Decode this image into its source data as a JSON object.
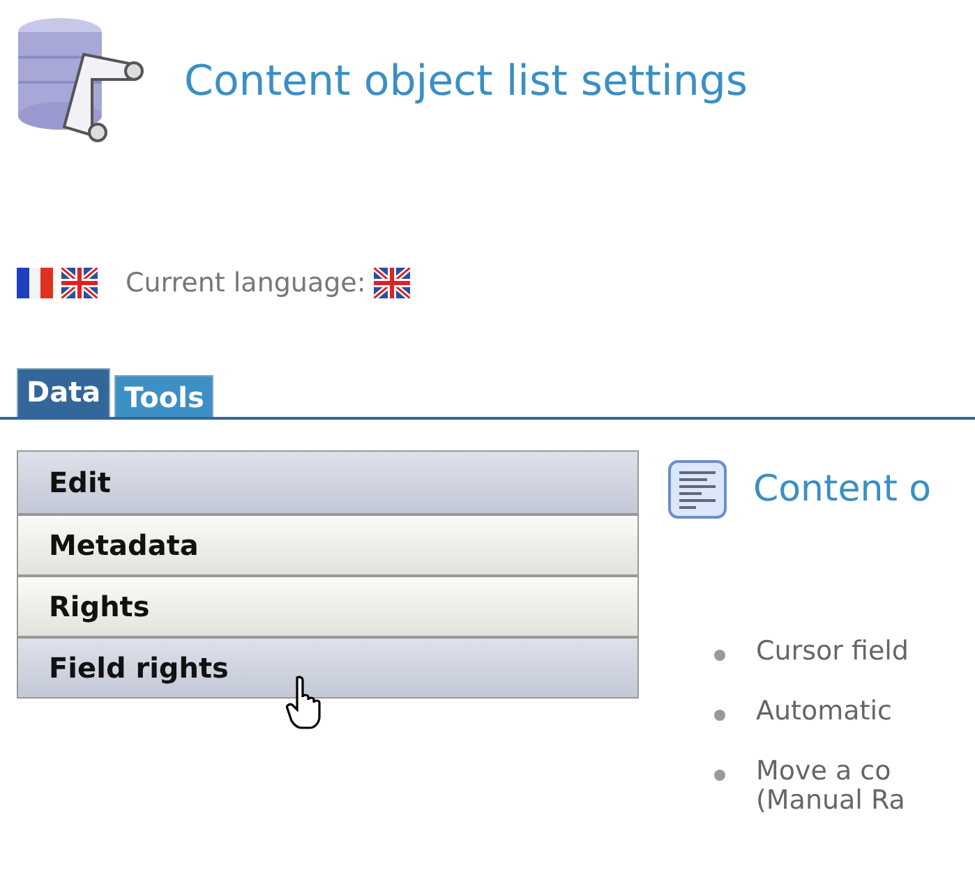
{
  "header": {
    "title": "Content object list settings"
  },
  "languages": {
    "flags": [
      {
        "kind": "fr"
      },
      {
        "kind": "uk"
      }
    ],
    "label": "Current language:",
    "current": {
      "kind": "uk"
    }
  },
  "tabs": [
    {
      "label": "Data",
      "selected": true
    },
    {
      "label": "Tools",
      "selected": false
    }
  ],
  "menu": [
    {
      "label": "Edit",
      "highlighted": true
    },
    {
      "label": "Metadata",
      "highlighted": false
    },
    {
      "label": "Rights",
      "highlighted": false
    },
    {
      "label": "Field rights",
      "highlighted": true
    }
  ],
  "panel": {
    "heading": "Content o",
    "bullets": [
      [
        "Cursor field"
      ],
      [
        "Automatic"
      ],
      [
        "Move a co",
        "(Manual Ra"
      ]
    ]
  }
}
